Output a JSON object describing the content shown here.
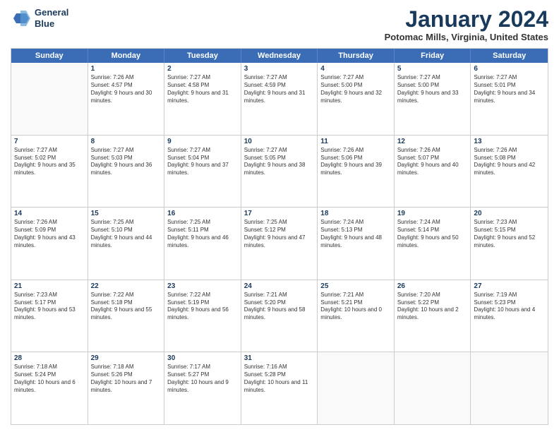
{
  "header": {
    "logo": {
      "line1": "General",
      "line2": "Blue"
    },
    "title": "January 2024",
    "location": "Potomac Mills, Virginia, United States"
  },
  "weekdays": [
    "Sunday",
    "Monday",
    "Tuesday",
    "Wednesday",
    "Thursday",
    "Friday",
    "Saturday"
  ],
  "rows": [
    [
      {
        "day": "",
        "sunrise": "",
        "sunset": "",
        "daylight": ""
      },
      {
        "day": "1",
        "sunrise": "Sunrise: 7:26 AM",
        "sunset": "Sunset: 4:57 PM",
        "daylight": "Daylight: 9 hours and 30 minutes."
      },
      {
        "day": "2",
        "sunrise": "Sunrise: 7:27 AM",
        "sunset": "Sunset: 4:58 PM",
        "daylight": "Daylight: 9 hours and 31 minutes."
      },
      {
        "day": "3",
        "sunrise": "Sunrise: 7:27 AM",
        "sunset": "Sunset: 4:59 PM",
        "daylight": "Daylight: 9 hours and 31 minutes."
      },
      {
        "day": "4",
        "sunrise": "Sunrise: 7:27 AM",
        "sunset": "Sunset: 5:00 PM",
        "daylight": "Daylight: 9 hours and 32 minutes."
      },
      {
        "day": "5",
        "sunrise": "Sunrise: 7:27 AM",
        "sunset": "Sunset: 5:00 PM",
        "daylight": "Daylight: 9 hours and 33 minutes."
      },
      {
        "day": "6",
        "sunrise": "Sunrise: 7:27 AM",
        "sunset": "Sunset: 5:01 PM",
        "daylight": "Daylight: 9 hours and 34 minutes."
      }
    ],
    [
      {
        "day": "7",
        "sunrise": "Sunrise: 7:27 AM",
        "sunset": "Sunset: 5:02 PM",
        "daylight": "Daylight: 9 hours and 35 minutes."
      },
      {
        "day": "8",
        "sunrise": "Sunrise: 7:27 AM",
        "sunset": "Sunset: 5:03 PM",
        "daylight": "Daylight: 9 hours and 36 minutes."
      },
      {
        "day": "9",
        "sunrise": "Sunrise: 7:27 AM",
        "sunset": "Sunset: 5:04 PM",
        "daylight": "Daylight: 9 hours and 37 minutes."
      },
      {
        "day": "10",
        "sunrise": "Sunrise: 7:27 AM",
        "sunset": "Sunset: 5:05 PM",
        "daylight": "Daylight: 9 hours and 38 minutes."
      },
      {
        "day": "11",
        "sunrise": "Sunrise: 7:26 AM",
        "sunset": "Sunset: 5:06 PM",
        "daylight": "Daylight: 9 hours and 39 minutes."
      },
      {
        "day": "12",
        "sunrise": "Sunrise: 7:26 AM",
        "sunset": "Sunset: 5:07 PM",
        "daylight": "Daylight: 9 hours and 40 minutes."
      },
      {
        "day": "13",
        "sunrise": "Sunrise: 7:26 AM",
        "sunset": "Sunset: 5:08 PM",
        "daylight": "Daylight: 9 hours and 42 minutes."
      }
    ],
    [
      {
        "day": "14",
        "sunrise": "Sunrise: 7:26 AM",
        "sunset": "Sunset: 5:09 PM",
        "daylight": "Daylight: 9 hours and 43 minutes."
      },
      {
        "day": "15",
        "sunrise": "Sunrise: 7:25 AM",
        "sunset": "Sunset: 5:10 PM",
        "daylight": "Daylight: 9 hours and 44 minutes."
      },
      {
        "day": "16",
        "sunrise": "Sunrise: 7:25 AM",
        "sunset": "Sunset: 5:11 PM",
        "daylight": "Daylight: 9 hours and 46 minutes."
      },
      {
        "day": "17",
        "sunrise": "Sunrise: 7:25 AM",
        "sunset": "Sunset: 5:12 PM",
        "daylight": "Daylight: 9 hours and 47 minutes."
      },
      {
        "day": "18",
        "sunrise": "Sunrise: 7:24 AM",
        "sunset": "Sunset: 5:13 PM",
        "daylight": "Daylight: 9 hours and 48 minutes."
      },
      {
        "day": "19",
        "sunrise": "Sunrise: 7:24 AM",
        "sunset": "Sunset: 5:14 PM",
        "daylight": "Daylight: 9 hours and 50 minutes."
      },
      {
        "day": "20",
        "sunrise": "Sunrise: 7:23 AM",
        "sunset": "Sunset: 5:15 PM",
        "daylight": "Daylight: 9 hours and 52 minutes."
      }
    ],
    [
      {
        "day": "21",
        "sunrise": "Sunrise: 7:23 AM",
        "sunset": "Sunset: 5:17 PM",
        "daylight": "Daylight: 9 hours and 53 minutes."
      },
      {
        "day": "22",
        "sunrise": "Sunrise: 7:22 AM",
        "sunset": "Sunset: 5:18 PM",
        "daylight": "Daylight: 9 hours and 55 minutes."
      },
      {
        "day": "23",
        "sunrise": "Sunrise: 7:22 AM",
        "sunset": "Sunset: 5:19 PM",
        "daylight": "Daylight: 9 hours and 56 minutes."
      },
      {
        "day": "24",
        "sunrise": "Sunrise: 7:21 AM",
        "sunset": "Sunset: 5:20 PM",
        "daylight": "Daylight: 9 hours and 58 minutes."
      },
      {
        "day": "25",
        "sunrise": "Sunrise: 7:21 AM",
        "sunset": "Sunset: 5:21 PM",
        "daylight": "Daylight: 10 hours and 0 minutes."
      },
      {
        "day": "26",
        "sunrise": "Sunrise: 7:20 AM",
        "sunset": "Sunset: 5:22 PM",
        "daylight": "Daylight: 10 hours and 2 minutes."
      },
      {
        "day": "27",
        "sunrise": "Sunrise: 7:19 AM",
        "sunset": "Sunset: 5:23 PM",
        "daylight": "Daylight: 10 hours and 4 minutes."
      }
    ],
    [
      {
        "day": "28",
        "sunrise": "Sunrise: 7:18 AM",
        "sunset": "Sunset: 5:24 PM",
        "daylight": "Daylight: 10 hours and 6 minutes."
      },
      {
        "day": "29",
        "sunrise": "Sunrise: 7:18 AM",
        "sunset": "Sunset: 5:26 PM",
        "daylight": "Daylight: 10 hours and 7 minutes."
      },
      {
        "day": "30",
        "sunrise": "Sunrise: 7:17 AM",
        "sunset": "Sunset: 5:27 PM",
        "daylight": "Daylight: 10 hours and 9 minutes."
      },
      {
        "day": "31",
        "sunrise": "Sunrise: 7:16 AM",
        "sunset": "Sunset: 5:28 PM",
        "daylight": "Daylight: 10 hours and 11 minutes."
      },
      {
        "day": "",
        "sunrise": "",
        "sunset": "",
        "daylight": ""
      },
      {
        "day": "",
        "sunrise": "",
        "sunset": "",
        "daylight": ""
      },
      {
        "day": "",
        "sunrise": "",
        "sunset": "",
        "daylight": ""
      }
    ]
  ]
}
